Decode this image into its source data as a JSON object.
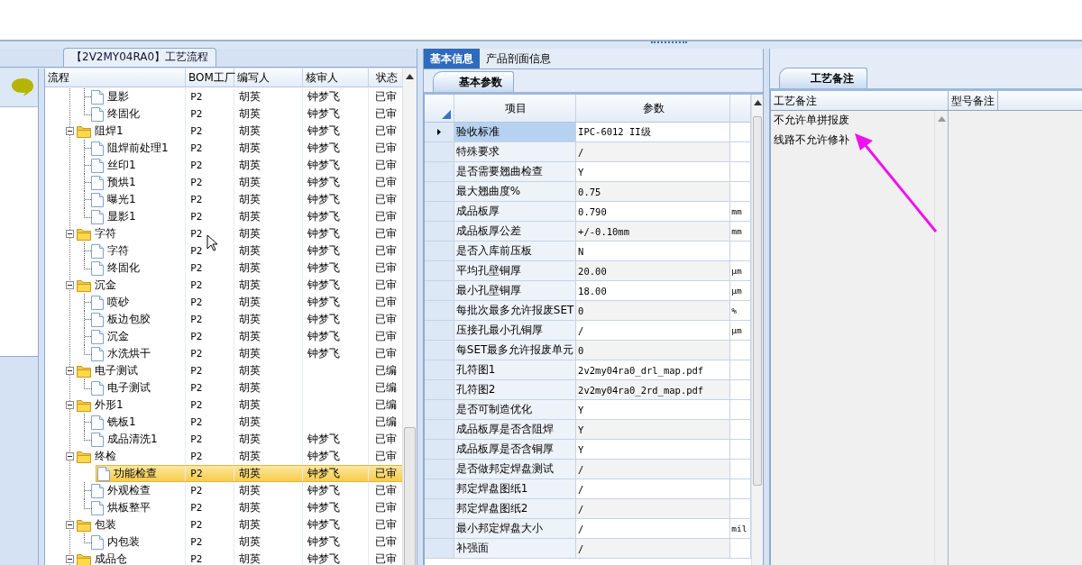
{
  "flow_panel": {
    "tab": "【2V2MY04RA0】工艺流程",
    "columns": [
      "流程",
      "BOM工厂",
      "编写人",
      "核审人",
      "状态"
    ],
    "tree": [
      {
        "children": [
          {
            "kind": "leaf",
            "label": "显影",
            "bom": "P2",
            "writer": "胡英",
            "reviewer": "钟梦飞",
            "status": "已审",
            "selected": false
          },
          {
            "kind": "leaf",
            "label": "终固化",
            "bom": "P2",
            "writer": "胡英",
            "reviewer": "钟梦飞",
            "status": "已审",
            "selected": false
          }
        ]
      },
      {
        "kind": "folder",
        "label": "阻焊1",
        "bom": "P2",
        "writer": "胡英",
        "reviewer": "钟梦飞",
        "status": "已审",
        "selected": false,
        "expanded": true,
        "children": [
          {
            "kind": "leaf",
            "label": "阻焊前处理1",
            "bom": "P2",
            "writer": "胡英",
            "reviewer": "钟梦飞",
            "status": "已审",
            "selected": false
          },
          {
            "kind": "leaf",
            "label": "丝印1",
            "bom": "P2",
            "writer": "胡英",
            "reviewer": "钟梦飞",
            "status": "已审",
            "selected": false
          },
          {
            "kind": "leaf",
            "label": "预烘1",
            "bom": "P2",
            "writer": "胡英",
            "reviewer": "钟梦飞",
            "status": "已审",
            "selected": false
          },
          {
            "kind": "leaf",
            "label": "曝光1",
            "bom": "P2",
            "writer": "胡英",
            "reviewer": "钟梦飞",
            "status": "已审",
            "selected": false
          },
          {
            "kind": "leaf",
            "label": "显影1",
            "bom": "P2",
            "writer": "胡英",
            "reviewer": "钟梦飞",
            "status": "已审",
            "selected": false
          }
        ]
      },
      {
        "kind": "folder",
        "label": "字符",
        "bom": "P2",
        "writer": "胡英",
        "reviewer": "钟梦飞",
        "status": "已审",
        "selected": false,
        "expanded": true,
        "children": [
          {
            "kind": "leaf",
            "label": "字符",
            "bom": "P2",
            "writer": "胡英",
            "reviewer": "钟梦飞",
            "status": "已审",
            "selected": false
          },
          {
            "kind": "leaf",
            "label": "终固化",
            "bom": "P2",
            "writer": "胡英",
            "reviewer": "钟梦飞",
            "status": "已审",
            "selected": false
          }
        ]
      },
      {
        "kind": "folder",
        "label": "沉金",
        "bom": "P2",
        "writer": "胡英",
        "reviewer": "钟梦飞",
        "status": "已审",
        "selected": false,
        "expanded": true,
        "children": [
          {
            "kind": "leaf",
            "label": "喷砂",
            "bom": "P2",
            "writer": "胡英",
            "reviewer": "钟梦飞",
            "status": "已审",
            "selected": false
          },
          {
            "kind": "leaf",
            "label": "板边包胶",
            "bom": "P2",
            "writer": "胡英",
            "reviewer": "钟梦飞",
            "status": "已审",
            "selected": false
          },
          {
            "kind": "leaf",
            "label": "沉金",
            "bom": "P2",
            "writer": "胡英",
            "reviewer": "钟梦飞",
            "status": "已审",
            "selected": false
          },
          {
            "kind": "leaf",
            "label": "水洗烘干",
            "bom": "P2",
            "writer": "胡英",
            "reviewer": "钟梦飞",
            "status": "已审",
            "selected": false
          }
        ]
      },
      {
        "kind": "folder",
        "label": "电子测试",
        "bom": "P2",
        "writer": "胡英",
        "status": "已编",
        "selected": false,
        "expanded": true,
        "children": [
          {
            "kind": "leaf",
            "label": "电子测试",
            "bom": "P2",
            "writer": "胡英",
            "status": "已编",
            "selected": false
          }
        ]
      },
      {
        "kind": "folder",
        "label": "外形1",
        "bom": "P2",
        "writer": "胡英",
        "status": "已编",
        "selected": false,
        "expanded": true,
        "children": [
          {
            "kind": "leaf",
            "label": "铣板1",
            "bom": "P2",
            "writer": "胡英",
            "status": "已编",
            "selected": false
          },
          {
            "kind": "leaf",
            "label": "成品清洗1",
            "bom": "P2",
            "writer": "胡英",
            "reviewer": "钟梦飞",
            "status": "已审",
            "selected": false
          }
        ]
      },
      {
        "kind": "folder",
        "label": "终检",
        "bom": "P2",
        "writer": "胡英",
        "reviewer": "钟梦飞",
        "status": "已审",
        "selected": false,
        "expanded": true,
        "children": [
          {
            "kind": "leaf",
            "label": "功能检查",
            "bom": "P2",
            "writer": "胡英",
            "reviewer": "钟梦飞",
            "status": "已审",
            "selected": true
          },
          {
            "kind": "leaf",
            "label": "外观检查",
            "bom": "P2",
            "writer": "胡英",
            "reviewer": "钟梦飞",
            "status": "已审",
            "selected": false
          },
          {
            "kind": "leaf",
            "label": "烘板整平",
            "bom": "P2",
            "writer": "胡英",
            "reviewer": "钟梦飞",
            "status": "已审",
            "selected": false
          }
        ]
      },
      {
        "kind": "folder",
        "label": "包装",
        "bom": "P2",
        "writer": "胡英",
        "reviewer": "钟梦飞",
        "status": "已审",
        "selected": false,
        "expanded": true,
        "children": [
          {
            "kind": "leaf",
            "label": "内包装",
            "bom": "P2",
            "writer": "胡英",
            "reviewer": "钟梦飞",
            "status": "已审",
            "selected": false
          }
        ]
      },
      {
        "kind": "folder",
        "label": "成品仓",
        "bom": "P2",
        "writer": "胡英",
        "reviewer": "钟梦飞",
        "status": "已审",
        "selected": false,
        "expanded": true
      }
    ]
  },
  "detail_panel": {
    "tabs": [
      {
        "label": "基本信息",
        "selected": true
      },
      {
        "label": "产品剖面信息",
        "selected": false
      }
    ],
    "subtab": "基本参数",
    "columns": [
      "项目",
      "参数"
    ],
    "rows": [
      {
        "item": "验收标准",
        "value": "IPC-6012 II级",
        "selected": true
      },
      {
        "item": "特殊要求",
        "value": "/",
        "selected": false
      },
      {
        "item": "是否需要翘曲检查",
        "value": "Y",
        "selected": false
      },
      {
        "item": "最大翘曲度%",
        "value": "0.75",
        "selected": false
      },
      {
        "item": "成品板厚",
        "value": "0.790",
        "unit": "mm",
        "selected": false
      },
      {
        "item": "成品板厚公差",
        "value": "+/-0.10mm",
        "unit": "mm",
        "selected": false
      },
      {
        "item": "是否入库前压板",
        "value": "N",
        "selected": false
      },
      {
        "item": "平均孔壁铜厚",
        "value": "20.00",
        "unit": "μm",
        "selected": false
      },
      {
        "item": "最小孔壁铜厚",
        "value": "18.00",
        "unit": "μm",
        "selected": false
      },
      {
        "item": "每批次最多允许报废SET",
        "value": "0",
        "unit": "%",
        "selected": false
      },
      {
        "item": "压接孔最小孔铜厚",
        "value": "/",
        "unit": "μm",
        "selected": false
      },
      {
        "item": "每SET最多允许报废单元",
        "value": "0",
        "selected": false
      },
      {
        "item": "孔符图1",
        "value": "2v2my04ra0_drl_map.pdf",
        "selected": false
      },
      {
        "item": "孔符图2",
        "value": "2v2my04ra0_2rd_map.pdf",
        "selected": false
      },
      {
        "item": "是否可制造优化",
        "value": "Y",
        "selected": false
      },
      {
        "item": "成品板厚是否含阻焊",
        "value": "Y",
        "selected": false
      },
      {
        "item": "成品板厚是否含铜厚",
        "value": "Y",
        "selected": false
      },
      {
        "item": "是否做邦定焊盘测试",
        "value": "/",
        "selected": false
      },
      {
        "item": "邦定焊盘图纸1",
        "value": "/",
        "selected": false
      },
      {
        "item": "邦定焊盘图纸2",
        "value": "/",
        "selected": false
      },
      {
        "item": "最小邦定焊盘大小",
        "value": "/",
        "unit": "mil",
        "selected": false
      },
      {
        "item": "补强面",
        "value": "/",
        "selected": false
      }
    ]
  },
  "notes_panel": {
    "tab": "工艺备注",
    "columns": [
      "工艺备注",
      "型号备注"
    ],
    "notes": [
      "不允许单拼报废",
      "线路不允许修补"
    ]
  }
}
